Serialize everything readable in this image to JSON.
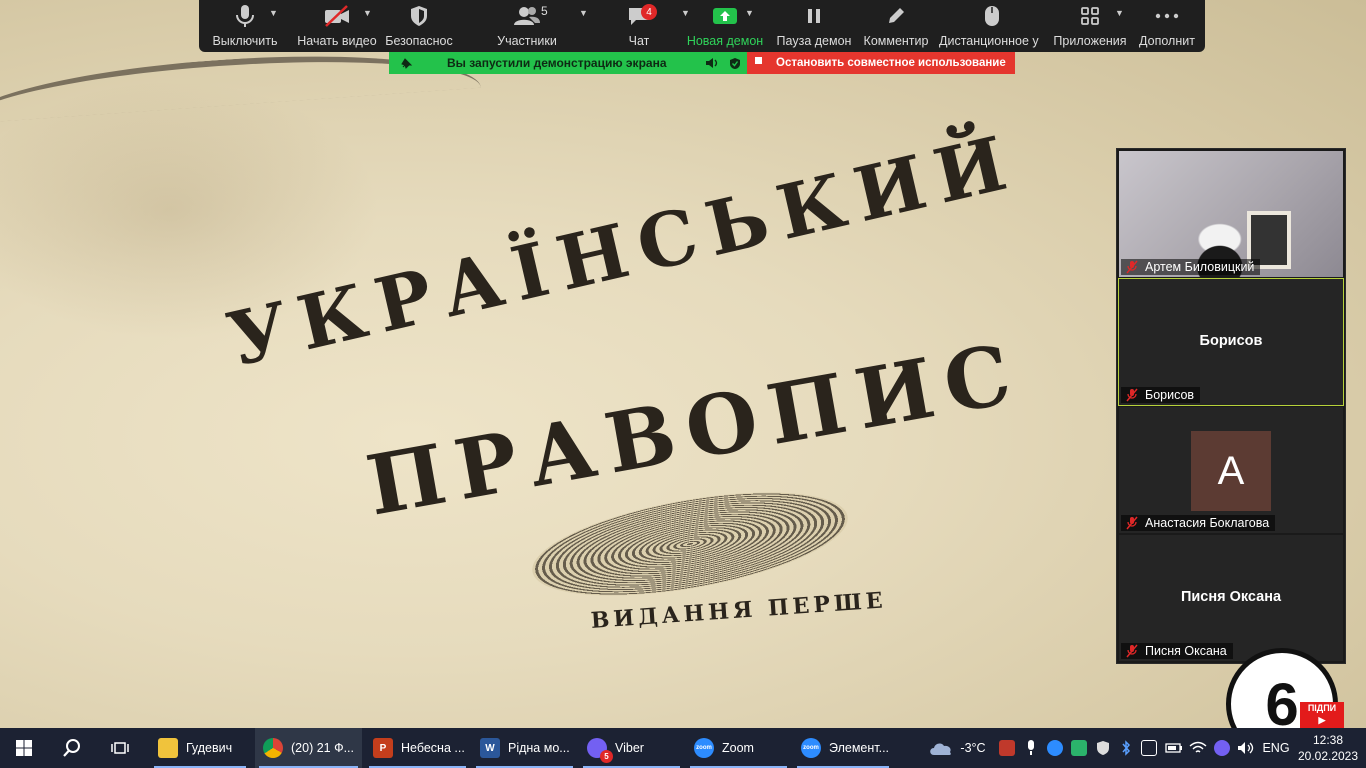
{
  "toolbar": {
    "mute_label": "Выключить",
    "video_label": "Начать видео",
    "security_label": "Безопаснос",
    "participants_label": "Участники",
    "participants_count": "5",
    "chat_label": "Чат",
    "chat_badge": "4",
    "new_share_label": "Новая демон",
    "pause_label": "Пауза демон",
    "annotate_label": "Комментир",
    "remote_label": "Дистанционное у",
    "apps_label": "Приложения",
    "more_label": "Дополнит"
  },
  "share_banner": {
    "text": "Вы запустили демонстрацию экрана",
    "stop_label": "Остановить совместное использование",
    "color": "#23c24b",
    "stop_color": "#e5362e"
  },
  "shared_screen": {
    "line1": "УКРАЇНСЬКИЙ",
    "line2": "ПРАВОПИС",
    "line3": "ВИДАННЯ ПЕРШЕ"
  },
  "participants": [
    {
      "name": "Артем Биловицкий",
      "type": "video"
    },
    {
      "name": "Борисов",
      "center": "Борисов",
      "type": "name",
      "active": true
    },
    {
      "name": "Анастасия Боклагова",
      "avatar_letter": "А",
      "type": "avatar"
    },
    {
      "name": "Писня Оксана",
      "center": "Писня Оксана",
      "type": "name"
    }
  ],
  "logo": {
    "number": "6",
    "subscribe": "ПІДПИ"
  },
  "taskbar": {
    "apps": [
      {
        "label": "Гудевич",
        "icon": "folder-icon",
        "color": "#f0c33c"
      },
      {
        "label": "(20) 21 Ф...",
        "icon": "chrome-icon",
        "color": "#dd4b39"
      },
      {
        "label": "Небесна ...",
        "icon": "powerpoint-icon",
        "color": "#c43e1c",
        "letter": "P"
      },
      {
        "label": "Рідна мо...",
        "icon": "word-icon",
        "color": "#2b579a",
        "letter": "W"
      },
      {
        "label": "Viber",
        "icon": "viber-icon",
        "color": "#7360f2",
        "badge": "5"
      },
      {
        "label": "Zoom",
        "icon": "zoom-icon",
        "color": "#2d8cff",
        "letter": "zoom"
      },
      {
        "label": "Элемент...",
        "icon": "zoom-icon",
        "color": "#2d8cff",
        "letter": "zoom"
      }
    ],
    "temperature": "-3°C",
    "language": "ENG",
    "time": "12:38",
    "date": "20.02.2023"
  }
}
